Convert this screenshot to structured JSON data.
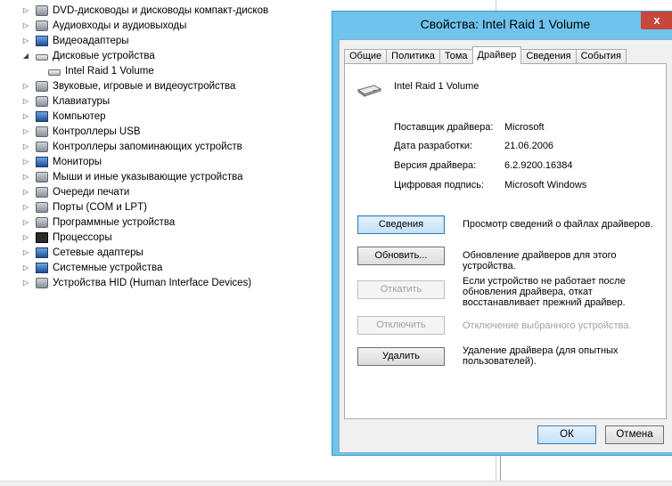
{
  "tree": {
    "items": [
      {
        "label": "DVD-дисководы и дисководы компакт-дисков",
        "expander": "▷",
        "icon": "dvd-drive-icon"
      },
      {
        "label": "Аудиовходы и аудиовыходы",
        "expander": "▷",
        "icon": "audio-io-icon"
      },
      {
        "label": "Видеоадаптеры",
        "expander": "▷",
        "icon": "display-adapter-icon"
      },
      {
        "label": "Дисковые устройства",
        "expander": "◢",
        "icon": "disk-drive-icon"
      },
      {
        "label": "Intel Raid 1 Volume",
        "expander": "",
        "icon": "disk-drive-icon"
      },
      {
        "label": "Звуковые, игровые и видеоустройства",
        "expander": "▷",
        "icon": "sound-icon"
      },
      {
        "label": "Клавиатуры",
        "expander": "▷",
        "icon": "keyboard-icon"
      },
      {
        "label": "Компьютер",
        "expander": "▷",
        "icon": "computer-icon"
      },
      {
        "label": "Контроллеры USB",
        "expander": "▷",
        "icon": "usb-icon"
      },
      {
        "label": "Контроллеры запоминающих устройств",
        "expander": "▷",
        "icon": "storage-controller-icon"
      },
      {
        "label": "Мониторы",
        "expander": "▷",
        "icon": "monitor-icon"
      },
      {
        "label": "Мыши и иные указывающие устройства",
        "expander": "▷",
        "icon": "mouse-icon"
      },
      {
        "label": "Очереди печати",
        "expander": "▷",
        "icon": "printer-icon"
      },
      {
        "label": "Порты (COM и LPT)",
        "expander": "▷",
        "icon": "port-icon"
      },
      {
        "label": "Программные устройства",
        "expander": "▷",
        "icon": "software-device-icon"
      },
      {
        "label": "Процессоры",
        "expander": "▷",
        "icon": "processor-icon"
      },
      {
        "label": "Сетевые адаптеры",
        "expander": "▷",
        "icon": "network-adapter-icon"
      },
      {
        "label": "Системные устройства",
        "expander": "▷",
        "icon": "system-device-icon"
      },
      {
        "label": "Устройства HID (Human Interface Devices)",
        "expander": "▷",
        "icon": "hid-icon"
      }
    ]
  },
  "dialog": {
    "title": "Свойства: Intel Raid 1 Volume",
    "close_label": "x",
    "tabs": [
      "Общие",
      "Политика",
      "Тома",
      "Драйвер",
      "Сведения",
      "События"
    ],
    "active_tab": "Драйвер",
    "device_name": "Intel Raid 1 Volume",
    "info": [
      {
        "label": "Поставщик драйвера:",
        "value": "Microsoft"
      },
      {
        "label": "Дата разработки:",
        "value": "21.06.2006"
      },
      {
        "label": "Версия драйвера:",
        "value": "6.2.9200.16384"
      },
      {
        "label": "Цифровая подпись:",
        "value": "Microsoft Windows"
      }
    ],
    "actions": [
      {
        "button": "Сведения",
        "description": "Просмотр сведений о файлах драйверов.",
        "enabled": true
      },
      {
        "button": "Обновить...",
        "description": "Обновление драйверов для этого устройства.",
        "enabled": true
      },
      {
        "button": "Откатить",
        "description": "Если устройство не работает после обновления драйвера, откат восстанавливает прежний драйвер.",
        "enabled": false
      },
      {
        "button": "Отключить",
        "description": "Отключение выбранного устройства.",
        "enabled": false
      },
      {
        "button": "Удалить",
        "description": "Удаление драйвера (для опытных пользователей).",
        "enabled": true
      }
    ],
    "ok_label": "ОК",
    "cancel_label": "Отмена"
  },
  "colors": {
    "window_frame": "#6fc3ed",
    "close_button": "#c7483a",
    "default_button_border": "#3c7fb1",
    "disabled_text": "#a0a0a0"
  }
}
